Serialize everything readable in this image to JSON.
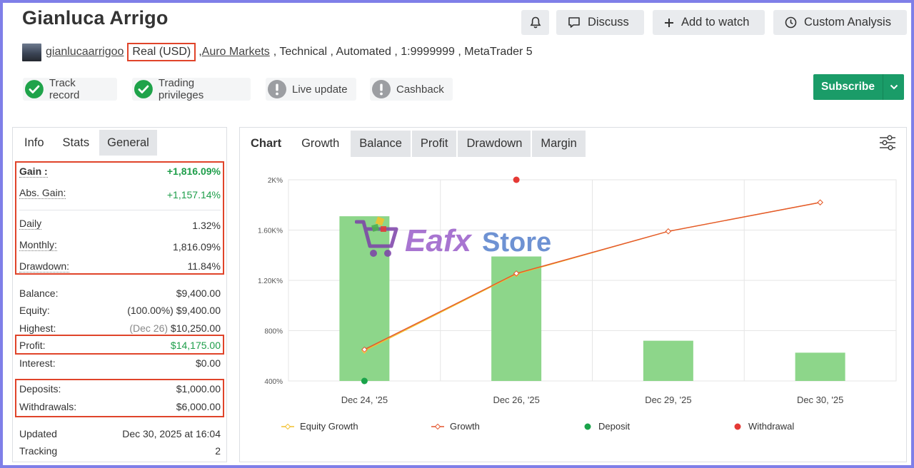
{
  "header": {
    "title": "Gianluca Arrigo",
    "buttons": {
      "discuss": "Discuss",
      "add_to_watch": "Add to watch",
      "custom_analysis": "Custom Analysis"
    }
  },
  "account": {
    "username": "gianlucaarrigoo",
    "type": "Real (USD)",
    "broker": "Auro Markets",
    "rest": ", Technical , Automated , 1:9999999 , MetaTrader 5",
    "sep": ","
  },
  "badges": {
    "track_record": "Track record",
    "trading_privileges": "Trading privileges",
    "live_update": "Live update",
    "cashback": "Cashback"
  },
  "subscribe": {
    "label": "Subscribe"
  },
  "left_tabs": {
    "info": "Info",
    "stats": "Stats",
    "general": "General"
  },
  "stats": {
    "gain": {
      "label": "Gain :",
      "value": "+1,816.09%"
    },
    "abs_gain": {
      "label": "Abs. Gain:",
      "value": "+1,157.14%"
    },
    "daily": {
      "label": "Daily",
      "value": "1.32%"
    },
    "monthly": {
      "label": "Monthly:",
      "value": "1,816.09%"
    },
    "drawdown": {
      "label": "Drawdown:",
      "value": "11.84%"
    },
    "balance": {
      "label": "Balance:",
      "value": "$9,400.00"
    },
    "equity": {
      "label": "Equity:",
      "pct": "(100.00%)",
      "value": "$9,400.00"
    },
    "highest": {
      "label": "Highest:",
      "date": "(Dec 26)",
      "value": "$10,250.00"
    },
    "profit": {
      "label": "Profit:",
      "value": "$14,175.00"
    },
    "interest": {
      "label": "Interest:",
      "value": "$0.00"
    },
    "deposits": {
      "label": "Deposits:",
      "value": "$1,000.00"
    },
    "withdrawals": {
      "label": "Withdrawals:",
      "value": "$6,000.00"
    },
    "updated": {
      "label": "Updated",
      "value": "Dec 30, 2025 at 16:04"
    },
    "tracking": {
      "label": "Tracking",
      "value": "2"
    }
  },
  "chart_tabs": {
    "chart": "Chart",
    "growth": "Growth",
    "balance": "Balance",
    "profit": "Profit",
    "drawdown": "Drawdown",
    "margin": "Margin"
  },
  "watermark": {
    "left": "Eafx",
    "right": "Store"
  },
  "chart_data": {
    "type": "bar",
    "categories": [
      "Dec 24, '25",
      "Dec 26, '25",
      "Dec 29, '25",
      "Dec 30, '25"
    ],
    "y_ticks": [
      "400%",
      "800%",
      "1.20K%",
      "1.60K%",
      "2K%"
    ],
    "ylim": [
      400,
      2000
    ],
    "series": [
      {
        "name": "Equity Growth",
        "type": "line",
        "color": "#f2c12e",
        "values": [
          640,
          1250,
          1590,
          1820
        ]
      },
      {
        "name": "Growth",
        "type": "line",
        "color": "#e4572e",
        "values": [
          650,
          1255,
          1590,
          1820
        ]
      },
      {
        "name": "Deposit",
        "type": "point",
        "color": "#1aa34a",
        "values": [
          400,
          null,
          null,
          null
        ]
      },
      {
        "name": "Withdrawal",
        "type": "point",
        "color": "#e53935",
        "values": [
          null,
          2000,
          null,
          null
        ]
      }
    ],
    "bars": {
      "color": "#8dd68a",
      "values": [
        1710,
        1390,
        720,
        625
      ]
    },
    "grid": true,
    "legend": "bottom"
  }
}
